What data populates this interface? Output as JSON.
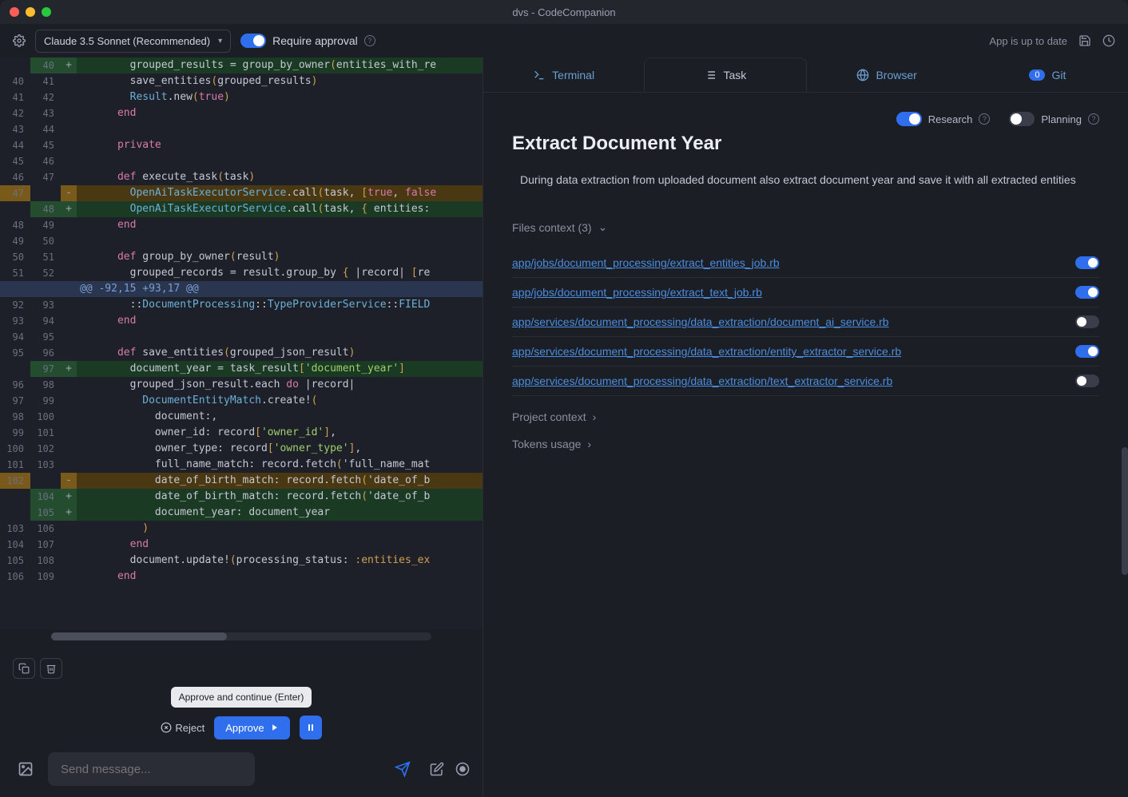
{
  "window": {
    "title": "dvs - CodeCompanion"
  },
  "toolbar": {
    "model": "Claude 3.5 Sonnet (Recommended)",
    "require_approval_label": "Require approval",
    "require_approval_on": true,
    "status": "App is up to date"
  },
  "diff": {
    "rows": [
      {
        "o": "",
        "n": "40",
        "s": "+",
        "t": "add",
        "code": "        grouped_results = group_by_owner(entities_with_re"
      },
      {
        "o": "40",
        "n": "41",
        "s": "",
        "t": "",
        "code": "        save_entities(grouped_results)"
      },
      {
        "o": "41",
        "n": "42",
        "s": "",
        "t": "",
        "code": "        Result.new(true)"
      },
      {
        "o": "42",
        "n": "43",
        "s": "",
        "t": "",
        "code": "      end"
      },
      {
        "o": "43",
        "n": "44",
        "s": "",
        "t": "",
        "code": ""
      },
      {
        "o": "44",
        "n": "45",
        "s": "",
        "t": "",
        "code": "      private"
      },
      {
        "o": "45",
        "n": "46",
        "s": "",
        "t": "",
        "code": ""
      },
      {
        "o": "46",
        "n": "47",
        "s": "",
        "t": "",
        "code": "      def execute_task(task)"
      },
      {
        "o": "47",
        "n": "",
        "s": "-",
        "t": "del",
        "code": "        OpenAiTaskExecutorService.call(task, [true, false"
      },
      {
        "o": "",
        "n": "48",
        "s": "+",
        "t": "add",
        "code": "        OpenAiTaskExecutorService.call(task, { entities:"
      },
      {
        "o": "48",
        "n": "49",
        "s": "",
        "t": "",
        "code": "      end"
      },
      {
        "o": "49",
        "n": "50",
        "s": "",
        "t": "",
        "code": ""
      },
      {
        "o": "50",
        "n": "51",
        "s": "",
        "t": "",
        "code": "      def group_by_owner(result)"
      },
      {
        "o": "51",
        "n": "52",
        "s": "",
        "t": "",
        "code": "        grouped_records = result.group_by { |record| [re"
      },
      {
        "o": "",
        "n": "",
        "s": "",
        "t": "hunk",
        "code": "@@ -92,15 +93,17 @@"
      },
      {
        "o": "92",
        "n": "93",
        "s": "",
        "t": "",
        "code": "        ::DocumentProcessing::TypeProviderService::FIELD"
      },
      {
        "o": "93",
        "n": "94",
        "s": "",
        "t": "",
        "code": "      end"
      },
      {
        "o": "94",
        "n": "95",
        "s": "",
        "t": "",
        "code": ""
      },
      {
        "o": "95",
        "n": "96",
        "s": "",
        "t": "",
        "code": "      def save_entities(grouped_json_result)"
      },
      {
        "o": "",
        "n": "97",
        "s": "+",
        "t": "add",
        "code": "        document_year = task_result['document_year']"
      },
      {
        "o": "96",
        "n": "98",
        "s": "",
        "t": "",
        "code": "        grouped_json_result.each do |record|"
      },
      {
        "o": "97",
        "n": "99",
        "s": "",
        "t": "",
        "code": "          DocumentEntityMatch.create!("
      },
      {
        "o": "98",
        "n": "100",
        "s": "",
        "t": "",
        "code": "            document:,"
      },
      {
        "o": "99",
        "n": "101",
        "s": "",
        "t": "",
        "code": "            owner_id: record['owner_id'],"
      },
      {
        "o": "100",
        "n": "102",
        "s": "",
        "t": "",
        "code": "            owner_type: record['owner_type'],"
      },
      {
        "o": "101",
        "n": "103",
        "s": "",
        "t": "",
        "code": "            full_name_match: record.fetch('full_name_mat"
      },
      {
        "o": "102",
        "n": "",
        "s": "-",
        "t": "del",
        "code": "            date_of_birth_match: record.fetch('date_of_b"
      },
      {
        "o": "",
        "n": "104",
        "s": "+",
        "t": "add",
        "code": "            date_of_birth_match: record.fetch('date_of_b"
      },
      {
        "o": "",
        "n": "105",
        "s": "+",
        "t": "add",
        "code": "            document_year: document_year"
      },
      {
        "o": "103",
        "n": "106",
        "s": "",
        "t": "",
        "code": "          )"
      },
      {
        "o": "104",
        "n": "107",
        "s": "",
        "t": "",
        "code": "        end"
      },
      {
        "o": "105",
        "n": "108",
        "s": "",
        "t": "",
        "code": "        document.update!(processing_status: :entities_ex"
      },
      {
        "o": "106",
        "n": "109",
        "s": "",
        "t": "",
        "code": "      end"
      }
    ]
  },
  "actions": {
    "tooltip": "Approve and continue (Enter)",
    "reject_label": "Reject",
    "approve_label": "Approve"
  },
  "sendbar": {
    "placeholder": "Send message..."
  },
  "tabs": {
    "terminal": "Terminal",
    "task": "Task",
    "browser": "Browser",
    "git": "Git",
    "git_badge": "0"
  },
  "task": {
    "research_label": "Research",
    "research_on": true,
    "planning_label": "Planning",
    "planning_on": false,
    "title": "Extract Document Year",
    "description": "During data extraction from uploaded document also extract document year and save it with all extracted entities",
    "files_context_label": "Files context (3)",
    "project_context_label": "Project context",
    "tokens_usage_label": "Tokens usage",
    "files": [
      {
        "path": "app/jobs/document_processing/extract_entities_job.rb",
        "on": true
      },
      {
        "path": "app/jobs/document_processing/extract_text_job.rb",
        "on": true
      },
      {
        "path": "app/services/document_processing/data_extraction/document_ai_service.rb",
        "on": false
      },
      {
        "path": "app/services/document_processing/data_extraction/entity_extractor_service.rb",
        "on": true
      },
      {
        "path": "app/services/document_processing/data_extraction/text_extractor_service.rb",
        "on": false
      }
    ]
  }
}
